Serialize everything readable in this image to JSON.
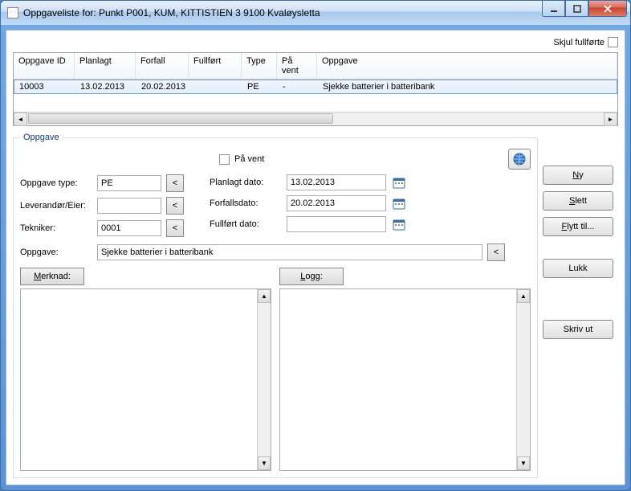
{
  "window": {
    "title": "Oppgaveliste for: Punkt P001, KUM, KITTISTIEN 3 9100 Kvaløysletta"
  },
  "topbar": {
    "hide_completed_label": "Skjul fullførte"
  },
  "grid": {
    "headers": {
      "id": "Oppgave ID",
      "planned": "Planlagt",
      "due": "Forfall",
      "completed": "Fullført",
      "type": "Type",
      "onhold": "På vent",
      "task": "Oppgave"
    },
    "rows": [
      {
        "id": "10003",
        "planned": "13.02.2013",
        "due": "20.02.2013",
        "completed": "",
        "type": "PE",
        "onhold": "-",
        "task": "Sjekke batterier i batteribank"
      }
    ]
  },
  "form": {
    "legend": "Oppgave",
    "onhold_label": "På vent",
    "type_label": "Oppgave type:",
    "type_value": "PE",
    "vendor_label": "Leverandør/Eier:",
    "vendor_value": "",
    "tech_label": "Tekniker:",
    "tech_value": "0001",
    "task_label": "Oppgave:",
    "task_value": "Sjekke batterier i batteribank",
    "planned_label": "Planlagt dato:",
    "planned_value": "13.02.2013",
    "due_label": "Forfallsdato:",
    "due_value": "20.02.2013",
    "completed_label": "Fullført dato:",
    "completed_value": "",
    "note_label_pre": "M",
    "note_label_rest": "erknad:",
    "log_label_pre": "L",
    "log_label_rest": "ogg:",
    "lookup": "<"
  },
  "actions": {
    "new_pre": "N",
    "new_rest": "y",
    "delete_pre": "S",
    "delete_rest": "lett",
    "move_pre": "F",
    "move_rest": "lytt til...",
    "close": "Lukk",
    "print": "Skriv ut"
  }
}
